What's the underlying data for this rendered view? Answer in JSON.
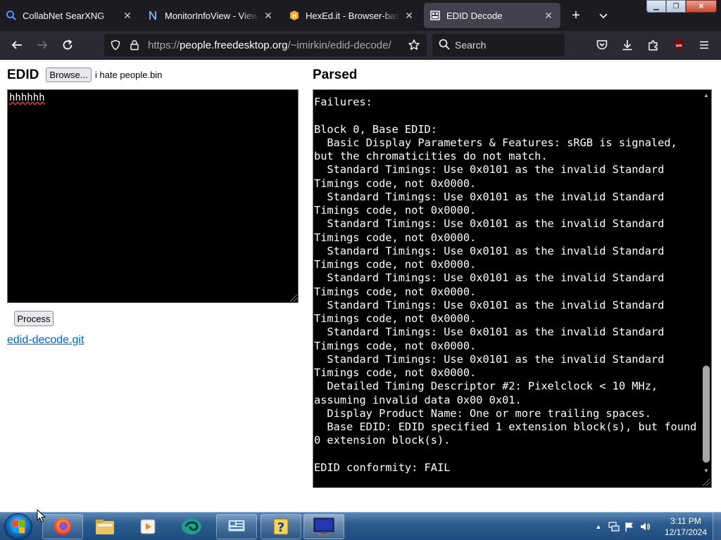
{
  "browser": {
    "tabs": [
      {
        "title": "CollabNet SearXNG",
        "icon": "search-icon",
        "active": false
      },
      {
        "title": "MonitorInfoView - View Monitor",
        "icon": "nirsoft-icon",
        "active": false
      },
      {
        "title": "HexEd.it - Browser-based Online",
        "icon": "hexed-icon",
        "active": false
      },
      {
        "title": "EDID Decode",
        "icon": "page-icon",
        "active": true
      }
    ],
    "url": {
      "scheme": "https://",
      "host": "people.freedesktop.org",
      "path": "/~imirkin/edid-decode/"
    },
    "search_placeholder": "Search",
    "accent_color": "#0060df"
  },
  "page": {
    "edid_heading": "EDID",
    "browse_label": "Browse...",
    "file_name": "i hate people.bin",
    "textarea_value": "hhhhhh",
    "process_label": "Process",
    "link_text": "edid-decode.git",
    "parsed_heading": "Parsed",
    "parsed_output": "Failures:\n\nBlock 0, Base EDID:\n  Basic Display Parameters & Features: sRGB is signaled, but the chromaticities do not match.\n  Standard Timings: Use 0x0101 as the invalid Standard Timings code, not 0x0000.\n  Standard Timings: Use 0x0101 as the invalid Standard Timings code, not 0x0000.\n  Standard Timings: Use 0x0101 as the invalid Standard Timings code, not 0x0000.\n  Standard Timings: Use 0x0101 as the invalid Standard Timings code, not 0x0000.\n  Standard Timings: Use 0x0101 as the invalid Standard Timings code, not 0x0000.\n  Standard Timings: Use 0x0101 as the invalid Standard Timings code, not 0x0000.\n  Standard Timings: Use 0x0101 as the invalid Standard Timings code, not 0x0000.\n  Standard Timings: Use 0x0101 as the invalid Standard Timings code, not 0x0000.\n  Detailed Timing Descriptor #2: Pixelclock < 10 MHz, assuming invalid data 0x00 0x01.\n  Display Product Name: One or more trailing spaces.\n  Base EDID: EDID specified 1 extension block(s), but found 0 extension block(s).\n\nEDID conformity: FAIL"
  },
  "taskbar": {
    "apps": [
      "firefox-icon",
      "file-explorer-icon",
      "media-player-icon",
      "swirl-app-icon",
      "control-panel-icon",
      "help-icon",
      "monitor-icon"
    ],
    "clock_time": "3:11 PM",
    "clock_date": "12/17/2024"
  }
}
